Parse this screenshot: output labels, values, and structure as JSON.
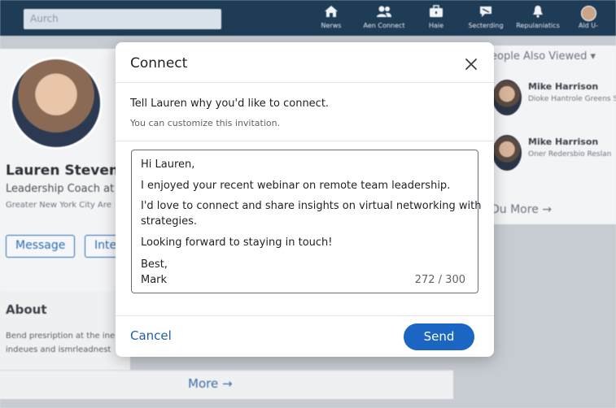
{
  "topnav": {
    "search_placeholder": "Aurch",
    "items": [
      {
        "icon": "home-icon",
        "label": "Nerws"
      },
      {
        "icon": "network-icon",
        "label": "Aen Connect"
      },
      {
        "icon": "jobs-icon",
        "label": "Haie"
      },
      {
        "icon": "messaging-icon",
        "label": "Secterding"
      },
      {
        "icon": "notifications-icon",
        "label": "Repulaniatics"
      },
      {
        "icon": "me-icon",
        "label": "Ald U-"
      }
    ]
  },
  "profile": {
    "name": "Lauren Stevens",
    "headline": "Leadership Coach at I",
    "location": "Greater New York City Are",
    "message_label": "Message",
    "second_button_label": "Inte"
  },
  "about": {
    "title": "About",
    "lines": [
      "Bend presription at the ine",
      "indeues and ismrleadnest"
    ]
  },
  "more_label": "More →",
  "sidebar": {
    "title": "eople Also Viewed ▾",
    "people": [
      {
        "name": "Mike Harrison",
        "desc": "Dioke Hantrole Greens Strenples."
      },
      {
        "name": "Mike Harrison",
        "desc": "Oner Redersbio Reslan"
      }
    ],
    "more_label": "Du More →"
  },
  "modal": {
    "title": "Connect",
    "intro_line": "Tell Lauren why you'd like to connect.",
    "intro_sub": "You can customize this invitation.",
    "message_lines": [
      "Hi Lauren,",
      "I enjoyed your recent webinar on remote team leadership.",
      "I'd love to connect and share insights on virtual networking with",
      "strategies.",
      "Looking forward to staying in touch!",
      "Best,",
      "Mark"
    ],
    "char_count": "272 / 300",
    "cancel_label": "Cancel",
    "send_label": "Send"
  }
}
